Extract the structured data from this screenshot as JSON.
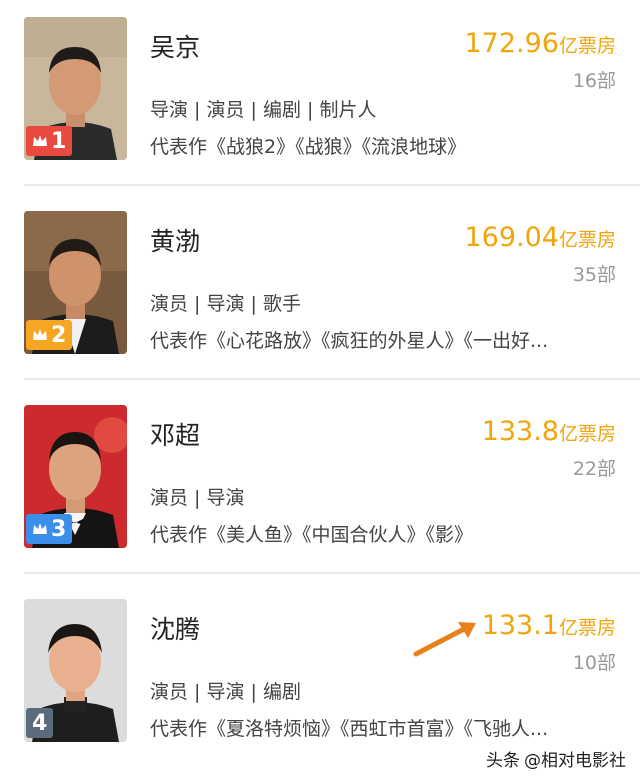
{
  "colors": {
    "accent": "#f0a50c",
    "rank1": "#e94a3f",
    "rank2": "#f5a623",
    "rank3": "#3b8fe8",
    "rank4": "#5b6b7c",
    "arrow": "#e8801c"
  },
  "rows": [
    {
      "rank": "1",
      "name": "吴京",
      "box_value": "172.96",
      "box_unit": "亿票房",
      "count": "16部",
      "roles": "导演 | 演员 | 编剧 | 制片人",
      "works": "代表作《战狼2》《战狼》《流浪地球》",
      "crown": true
    },
    {
      "rank": "2",
      "name": "黄渤",
      "box_value": "169.04",
      "box_unit": "亿票房",
      "count": "35部",
      "roles": "演员 | 导演 | 歌手",
      "works": "代表作《心花路放》《疯狂的外星人》《一出好...",
      "crown": true
    },
    {
      "rank": "3",
      "name": "邓超",
      "box_value": "133.8",
      "box_unit": "亿票房",
      "count": "22部",
      "roles": "演员 | 导演",
      "works": "代表作《美人鱼》《中国合伙人》《影》",
      "crown": true
    },
    {
      "rank": "4",
      "name": "沈腾",
      "box_value": "133.1",
      "box_unit": "亿票房",
      "count": "10部",
      "roles": "演员 | 导演 | 编剧",
      "works": "代表作《夏洛特烦恼》《西虹市首富》《飞驰人...",
      "crown": false
    }
  ],
  "watermark": {
    "platform": "头条",
    "handle": "@相对电影社"
  }
}
